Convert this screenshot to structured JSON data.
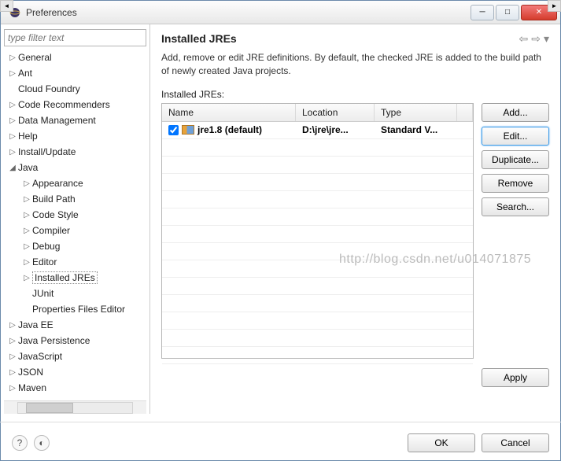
{
  "window": {
    "title": "Preferences"
  },
  "filter": {
    "placeholder": "type filter text"
  },
  "tree": {
    "items": [
      {
        "label": "General",
        "expanded": false,
        "level": 1
      },
      {
        "label": "Ant",
        "expanded": false,
        "level": 1
      },
      {
        "label": "Cloud Foundry",
        "expanded": null,
        "level": 1
      },
      {
        "label": "Code Recommenders",
        "expanded": false,
        "level": 1
      },
      {
        "label": "Data Management",
        "expanded": false,
        "level": 1
      },
      {
        "label": "Help",
        "expanded": false,
        "level": 1
      },
      {
        "label": "Install/Update",
        "expanded": false,
        "level": 1
      },
      {
        "label": "Java",
        "expanded": true,
        "level": 1
      },
      {
        "label": "Appearance",
        "expanded": false,
        "level": 2
      },
      {
        "label": "Build Path",
        "expanded": false,
        "level": 2
      },
      {
        "label": "Code Style",
        "expanded": false,
        "level": 2
      },
      {
        "label": "Compiler",
        "expanded": false,
        "level": 2
      },
      {
        "label": "Debug",
        "expanded": false,
        "level": 2
      },
      {
        "label": "Editor",
        "expanded": false,
        "level": 2
      },
      {
        "label": "Installed JREs",
        "expanded": false,
        "level": 2,
        "selected": true
      },
      {
        "label": "JUnit",
        "expanded": null,
        "level": 2
      },
      {
        "label": "Properties Files Editor",
        "expanded": null,
        "level": 2
      },
      {
        "label": "Java EE",
        "expanded": false,
        "level": 1
      },
      {
        "label": "Java Persistence",
        "expanded": false,
        "level": 1
      },
      {
        "label": "JavaScript",
        "expanded": false,
        "level": 1
      },
      {
        "label": "JSON",
        "expanded": false,
        "level": 1
      },
      {
        "label": "Maven",
        "expanded": false,
        "level": 1
      }
    ]
  },
  "main": {
    "heading": "Installed JREs",
    "description": "Add, remove or edit JRE definitions. By default, the checked JRE is added to the build path of newly created Java projects.",
    "table_label": "Installed JREs:",
    "columns": {
      "name": "Name",
      "location": "Location",
      "type": "Type"
    },
    "rows": [
      {
        "checked": true,
        "name": "jre1.8 (default)",
        "location": "D:\\jre\\jre...",
        "type": "Standard V..."
      }
    ],
    "buttons": {
      "add": "Add...",
      "edit": "Edit...",
      "duplicate": "Duplicate...",
      "remove": "Remove",
      "search": "Search..."
    },
    "apply": "Apply"
  },
  "footer": {
    "ok": "OK",
    "cancel": "Cancel"
  },
  "watermark": "http://blog.csdn.net/u014071875"
}
